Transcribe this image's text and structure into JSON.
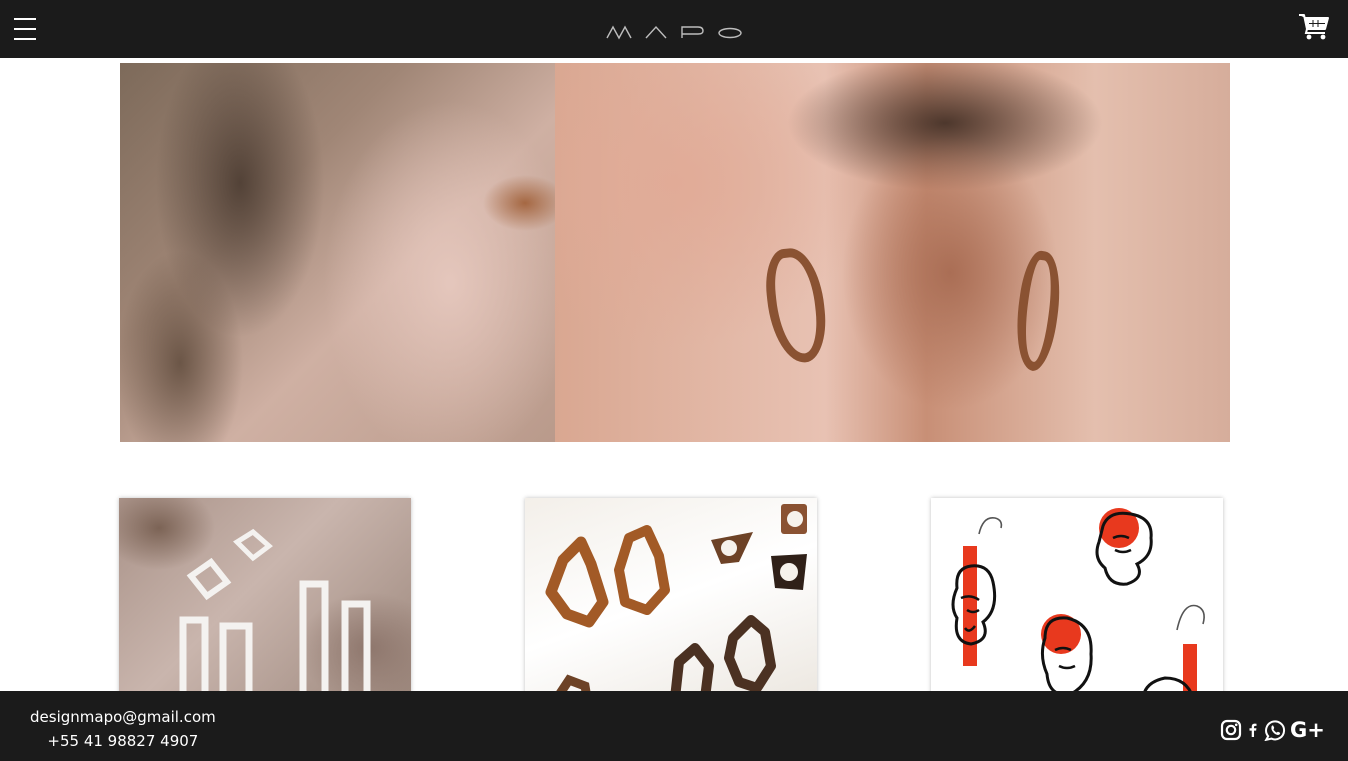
{
  "header": {
    "brand": "MAPO",
    "menu_icon": "hamburger-menu-icon",
    "cart_icon": "shopping-cart-icon"
  },
  "hero": {
    "image": "rock-texture-and-woman-with-wooden-earrings-photo"
  },
  "products": [
    {
      "image": "white-geometric-earrings-on-rock-photo"
    },
    {
      "image": "wooden-organic-earrings-and-rings-photo"
    },
    {
      "image": "black-face-line-art-earrings-with-red-photo"
    }
  ],
  "footer": {
    "email": "designmapo@gmail.com",
    "phone": "+55 41 98827 4907",
    "social": {
      "instagram_icon": "instagram-icon",
      "facebook_icon": "facebook-icon",
      "whatsapp_icon": "whatsapp-icon",
      "google_plus_label": "G+"
    }
  },
  "colors": {
    "bar_background": "#1b1b1b",
    "text_light": "#ffffff",
    "accent_red": "#e8391e",
    "wood": "#8a5232"
  }
}
